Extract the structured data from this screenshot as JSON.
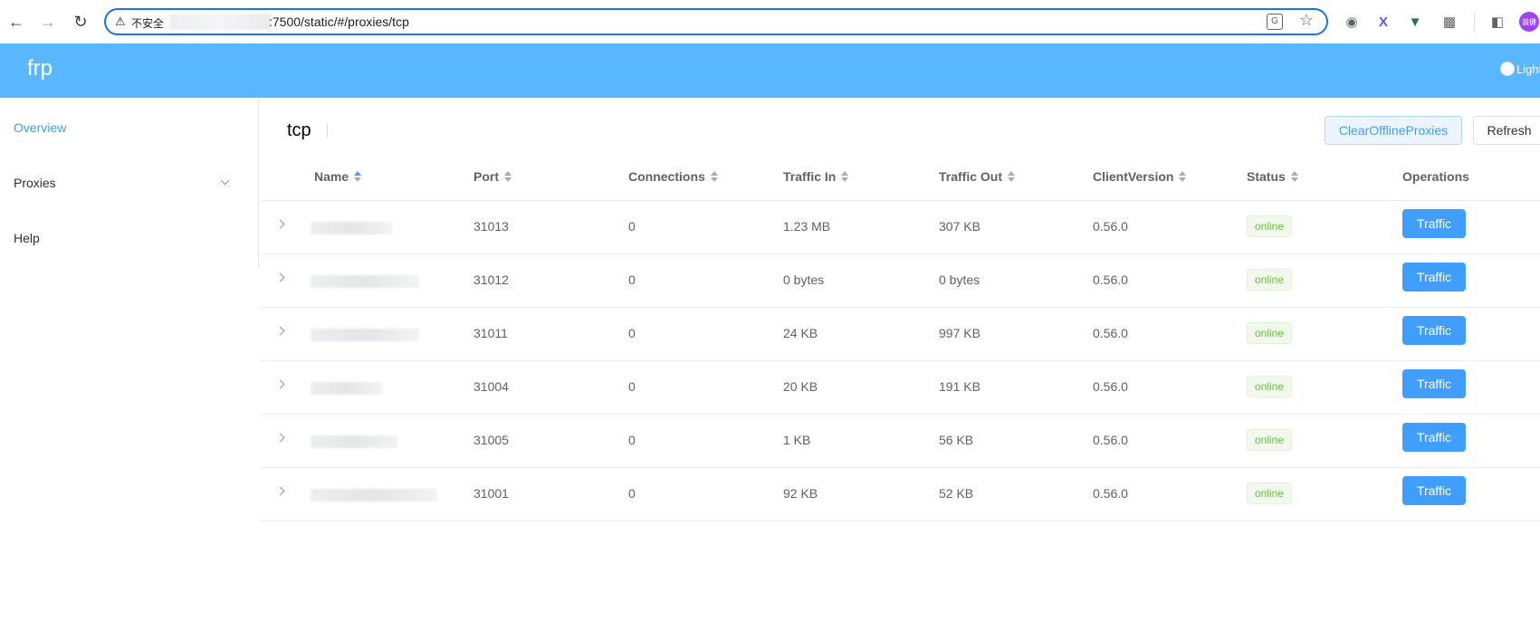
{
  "browser": {
    "insecure_label": "不安全",
    "url": ":7500/static/#/proxies/tcp",
    "profile_label": "翁健"
  },
  "header": {
    "brand": "frp",
    "theme_label": "Light"
  },
  "sidebar": {
    "items": [
      {
        "label": "Overview",
        "active": true
      },
      {
        "label": "Proxies",
        "expandable": true
      },
      {
        "label": "Help"
      }
    ]
  },
  "main": {
    "title": "tcp",
    "clear_button": "ClearOfflineProxies",
    "refresh_button": "Refresh"
  },
  "table": {
    "columns": [
      "Name",
      "Port",
      "Connections",
      "Traffic In",
      "Traffic Out",
      "ClientVersion",
      "Status",
      "Operations"
    ],
    "action_label": "Traffic",
    "rows": [
      {
        "port": "31013",
        "connections": "0",
        "traffic_in": "1.23 MB",
        "traffic_out": "307 KB",
        "client_version": "0.56.0",
        "status": "online"
      },
      {
        "port": "31012",
        "connections": "0",
        "traffic_in": "0 bytes",
        "traffic_out": "0 bytes",
        "client_version": "0.56.0",
        "status": "online"
      },
      {
        "port": "31011",
        "connections": "0",
        "traffic_in": "24 KB",
        "traffic_out": "997 KB",
        "client_version": "0.56.0",
        "status": "online"
      },
      {
        "port": "31004",
        "connections": "0",
        "traffic_in": "20 KB",
        "traffic_out": "191 KB",
        "client_version": "0.56.0",
        "status": "online"
      },
      {
        "port": "31005",
        "connections": "0",
        "traffic_in": "1 KB",
        "traffic_out": "56 KB",
        "client_version": "0.56.0",
        "status": "online"
      },
      {
        "port": "31001",
        "connections": "0",
        "traffic_in": "92 KB",
        "traffic_out": "52 KB",
        "client_version": "0.56.0",
        "status": "online"
      }
    ]
  },
  "colors": {
    "header_bg": "#58b7ff",
    "primary": "#409eff",
    "success": "#67c23a"
  }
}
